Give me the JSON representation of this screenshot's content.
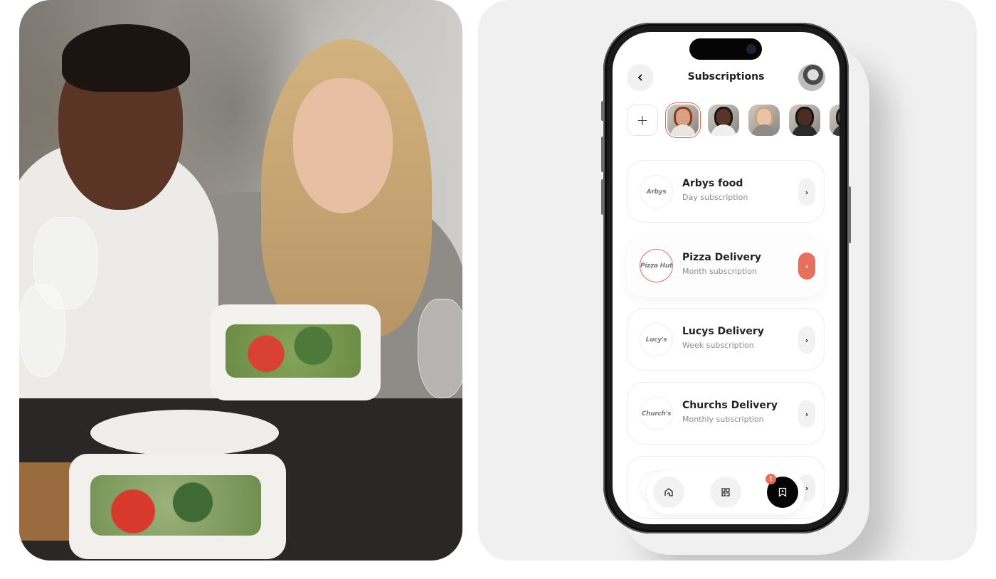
{
  "photo": {
    "description": "Two people sharing a salad at a restaurant table"
  },
  "app": {
    "title": "Subscriptions",
    "back_icon": "chevron-left-icon",
    "profile_icon": "user-avatar"
  },
  "friends": {
    "add_label": "+",
    "items": [
      {
        "name": "friend-1",
        "selected": true,
        "skin": "#d7a184",
        "hair": "#8a3b22",
        "shirt": "#e9e6e2"
      },
      {
        "name": "friend-2",
        "selected": false,
        "skin": "#5a3526",
        "hair": "#1b1410",
        "shirt": "#f1f0ee"
      },
      {
        "name": "friend-3",
        "selected": false,
        "skin": "#e9c2a8",
        "hair": "#c9a878",
        "shirt": "#8f8b86"
      },
      {
        "name": "friend-4",
        "selected": false,
        "skin": "#4a2d22",
        "hair": "#1a1411",
        "shirt": "#2a2a2a"
      },
      {
        "name": "friend-5",
        "selected": false,
        "skin": "#6b4a38",
        "hair": "#1e1915",
        "shirt": "#3a3a3a"
      }
    ]
  },
  "subscriptions": [
    {
      "logo": "Arbys",
      "name": "Arbys food",
      "plan": "Day subscription",
      "active": false
    },
    {
      "logo": "Pizza Hut",
      "name": "Pizza Delivery",
      "plan": "Month subscription",
      "active": true
    },
    {
      "logo": "Lucy's",
      "name": "Lucys Delivery",
      "plan": "Week  subscription",
      "active": false
    },
    {
      "logo": "Church's",
      "name": "Churchs Delivery",
      "plan": "Monthly subscription",
      "active": false
    },
    {
      "logo": "",
      "name": "",
      "plan": "",
      "active": false
    }
  ],
  "chevron": "›",
  "nav": {
    "items": [
      {
        "icon": "home-icon",
        "active": false
      },
      {
        "icon": "qr-scan-icon",
        "active": false
      },
      {
        "icon": "bookmark-icon",
        "active": true,
        "badge": "!"
      }
    ]
  },
  "colors": {
    "accent": "#e5705e",
    "panel_bg": "#f0f0f0",
    "text_primary": "#232323",
    "text_secondary": "#8b8b8b"
  }
}
